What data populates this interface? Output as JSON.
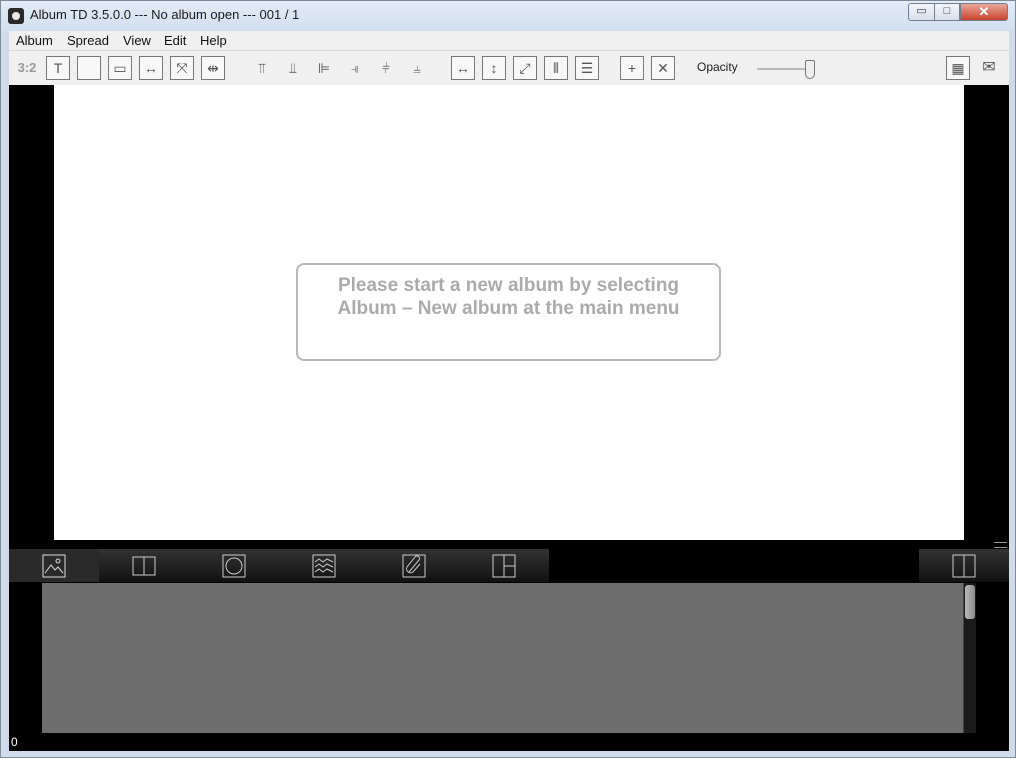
{
  "window": {
    "title": "Album TD 3.5.0.0 --- No album open --- 001 / 1",
    "buttons": {
      "minimize": "▭",
      "maximize": "□",
      "close": "✕"
    }
  },
  "menu": {
    "items": [
      {
        "label": "Album"
      },
      {
        "label": "Spread"
      },
      {
        "label": "View"
      },
      {
        "label": "Edit"
      },
      {
        "label": "Help"
      }
    ]
  },
  "toolbar": {
    "ratio_label": "3:2",
    "opacity_label": "Opacity",
    "opacity_value": 0.85,
    "icons": [
      "text-frame-icon",
      "picture-frame-icon",
      "fit-frame-icon",
      "fit-width-icon",
      "fill-frame-icon",
      "mirror-icon",
      "align-top-icon",
      "align-bottom-icon",
      "align-left-icon",
      "align-right-icon",
      "align-vcenter-icon",
      "align-hcenter-icon",
      "equal-width-icon",
      "equal-height-icon",
      "equal-size-icon",
      "distribute-horizontal-icon",
      "distribute-vertical-icon",
      "add-frame-icon",
      "delete-frame-icon",
      "grid-icon",
      "comment-icon"
    ]
  },
  "canvas": {
    "message_line1": "Please start a new album by selecting",
    "message_line2": "Album – New album at the main menu"
  },
  "panel": {
    "tabs": [
      "images-tab",
      "layouts-tab",
      "masks-tab",
      "backgrounds-tab",
      "clipart-tab",
      "templates-tab"
    ],
    "count": "0"
  }
}
